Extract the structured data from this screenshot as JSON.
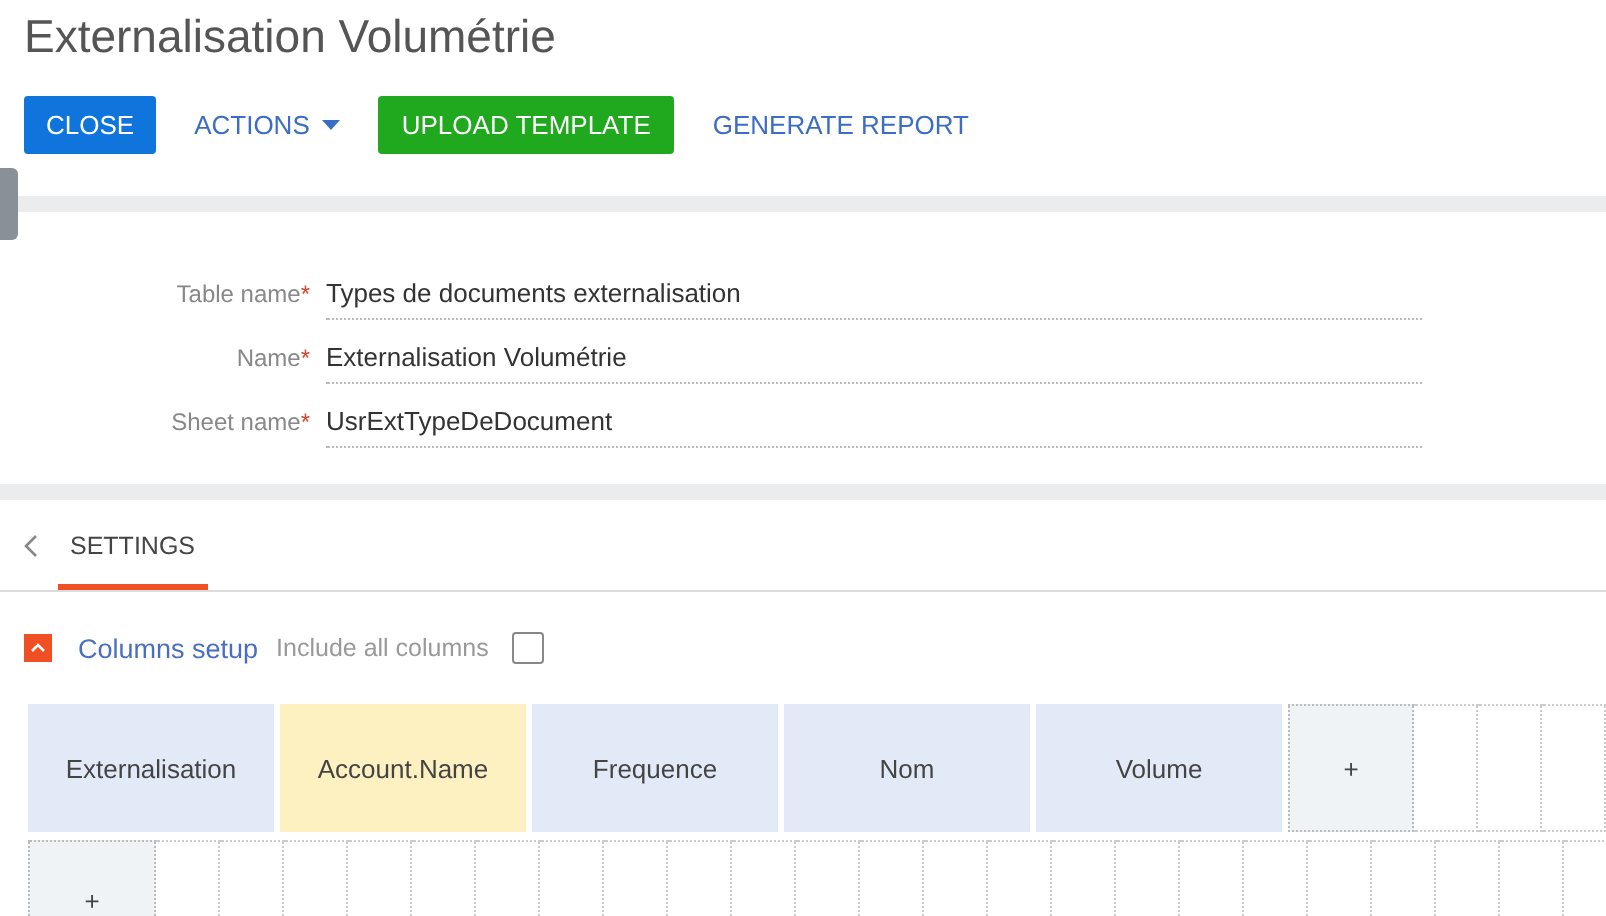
{
  "page": {
    "title": "Externalisation Volumétrie"
  },
  "toolbar": [
    {
      "label": "CLOSE",
      "kind": "primary"
    },
    {
      "label": "ACTIONS",
      "kind": "dropdown"
    },
    {
      "label": "UPLOAD TEMPLATE",
      "kind": "success"
    },
    {
      "label": "GENERATE REPORT",
      "kind": "link"
    }
  ],
  "fields": [
    {
      "label": "Table name",
      "required_mark": "*",
      "value": "Types de documents externalisation"
    },
    {
      "label": "Name",
      "required_mark": "*",
      "value": "Externalisation Volumétrie"
    },
    {
      "label": "Sheet name",
      "required_mark": "*",
      "value": "UsrExtTypeDeDocument"
    }
  ],
  "tabs": [
    {
      "label": "SETTINGS",
      "selected": true
    }
  ],
  "columns_setup": {
    "title": "Columns setup",
    "expanded": true,
    "include_all_label": "Include all columns",
    "include_all_checked": false
  },
  "grid": {
    "columns": [
      {
        "label": "Externalisation",
        "selected": false
      },
      {
        "label": "Account.Name",
        "selected": true
      },
      {
        "label": "Frequence",
        "selected": false
      },
      {
        "label": "Nom",
        "selected": false
      },
      {
        "label": "Volume",
        "selected": false
      }
    ],
    "add_column": "+",
    "add_row": "+"
  }
}
